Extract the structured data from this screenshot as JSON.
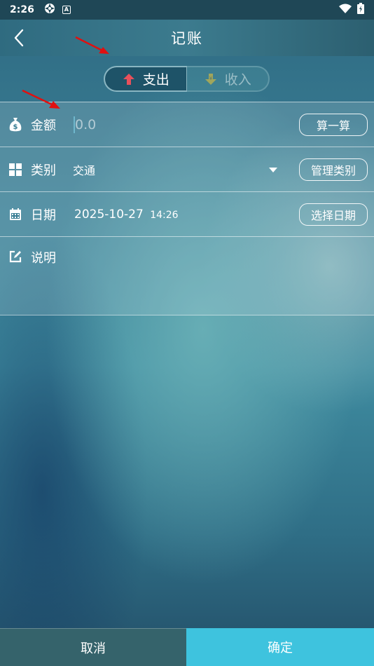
{
  "status_bar": {
    "time": "2:26"
  },
  "header": {
    "title": "记账",
    "back_icon": "chevron-left-icon"
  },
  "type_toggle": {
    "expense_label": "支出",
    "income_label": "收入",
    "selected": "支出",
    "expense_color": "#e8505b",
    "income_color": "#c2b34a"
  },
  "form": {
    "amount": {
      "label": "金额",
      "placeholder": "0.0",
      "button": "算一算"
    },
    "category": {
      "label": "类别",
      "value": "交通",
      "button": "管理类别"
    },
    "date": {
      "label": "日期",
      "date": "2025-10-27",
      "time": "14:26",
      "button": "选择日期"
    },
    "description": {
      "label": "说明"
    }
  },
  "actions": {
    "cancel": "取消",
    "confirm": "确定"
  },
  "colors": {
    "confirm_button": "#3ec3de",
    "annotation_arrow": "#e01010"
  }
}
